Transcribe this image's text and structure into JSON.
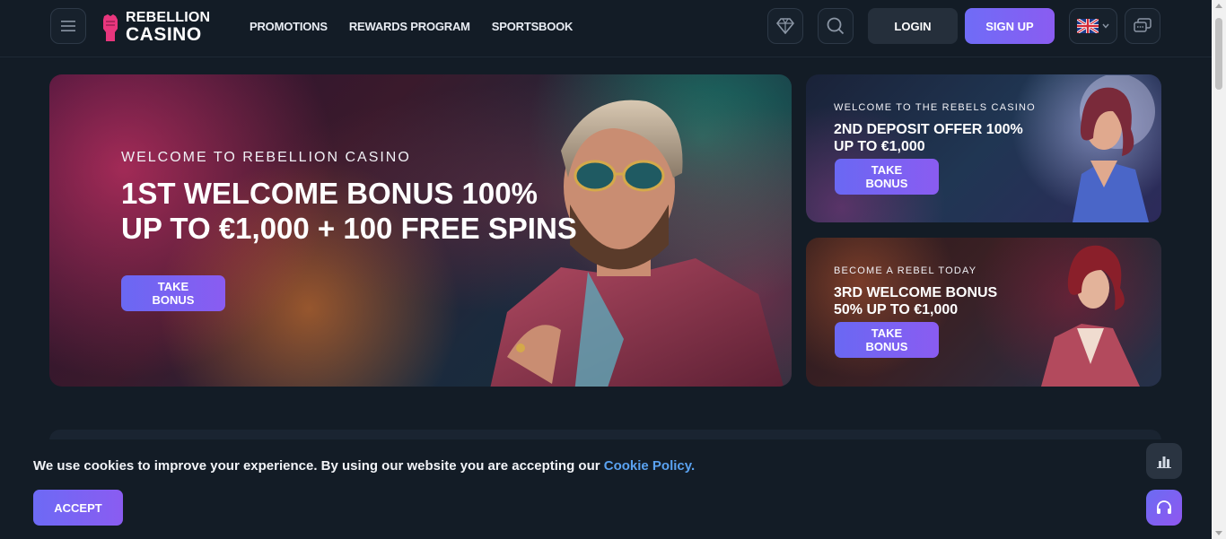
{
  "header": {
    "logo": {
      "line1": "REBELLION",
      "line2": "CASINO"
    },
    "nav": [
      {
        "label": "PROMOTIONS"
      },
      {
        "label": "REWARDS PROGRAM"
      },
      {
        "label": "SPORTSBOOK"
      }
    ],
    "login_label": "LOGIN",
    "signup_label": "SIGN UP",
    "icons": [
      "menu-icon",
      "gem-icon",
      "search-icon",
      "uk-flag-icon",
      "chevron-down-icon",
      "chat-icon"
    ]
  },
  "banners": {
    "main": {
      "kicker": "WELCOME TO REBELLION CASINO",
      "title_line1": "1ST WELCOME BONUS 100%",
      "title_line2": "UP TO €1,000 + 100 FREE SPINS",
      "button": "TAKE BONUS"
    },
    "side1": {
      "kicker": "WELCOME TO THE REBELS CASINO",
      "title_line1": "2ND DEPOSIT OFFER 100%",
      "title_line2": "UP TO €1,000",
      "button": "TAKE BONUS"
    },
    "side2": {
      "kicker": "BECOME A REBEL TODAY",
      "title_line1": "3RD WELCOME BONUS",
      "title_line2": "50% UP TO €1,000",
      "button": "TAKE BONUS"
    }
  },
  "cookie": {
    "text": "We use cookies to improve your experience. By using our website you are accepting our",
    "link": "Cookie Policy.",
    "accept": "ACCEPT"
  },
  "colors": {
    "background": "#131c26",
    "accent": "#7b63f3",
    "logo_pink": "#e8367d",
    "link": "#5aa2f0"
  }
}
